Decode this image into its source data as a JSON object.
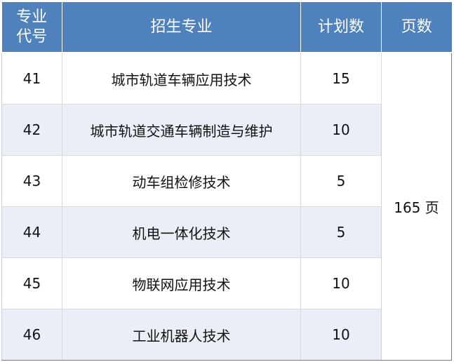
{
  "header": {
    "code_line1": "专业",
    "code_line2": "代号",
    "major": "招生专业",
    "plan": "计划数",
    "pages": "页数"
  },
  "rows": [
    {
      "code": "41",
      "major": "城市轨道车辆应用技术",
      "plan": "15"
    },
    {
      "code": "42",
      "major": "城市轨道交通车辆制造与维护",
      "plan": "10"
    },
    {
      "code": "43",
      "major": "动车组检修技术",
      "plan": "5"
    },
    {
      "code": "44",
      "major": "机电一体化技术",
      "plan": "5"
    },
    {
      "code": "45",
      "major": "物联网应用技术",
      "plan": "10"
    },
    {
      "code": "46",
      "major": "工业机器人技术",
      "plan": "10"
    }
  ],
  "pages_value": "165 页",
  "colors": {
    "header_bg": "#4f81bd",
    "stripe_bg": "#e9eef7"
  }
}
